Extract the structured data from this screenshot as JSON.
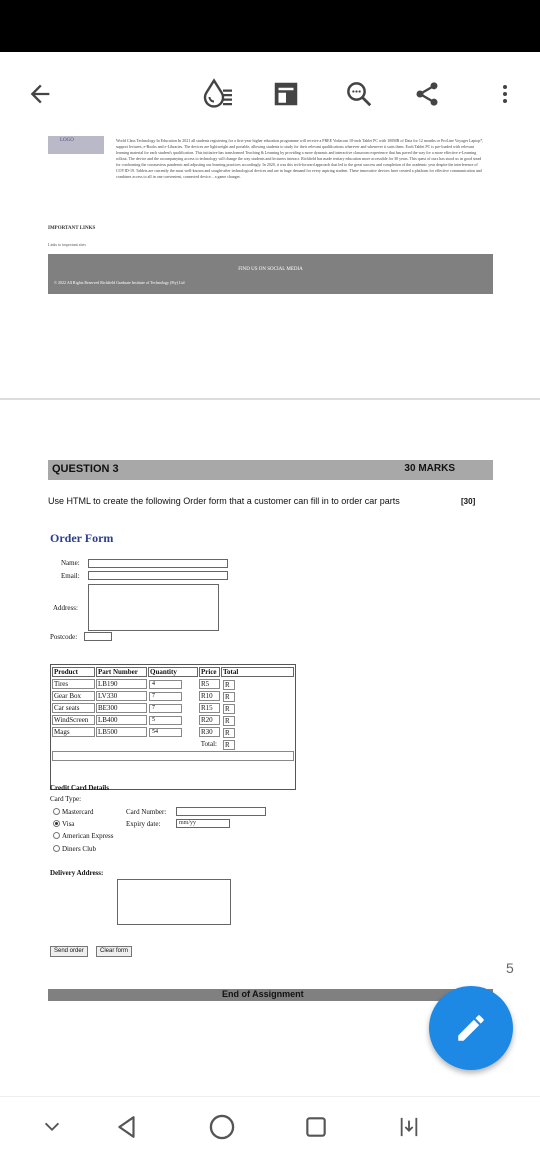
{
  "toolbar": {
    "icons": [
      "back-arrow-icon",
      "color-drop-icon",
      "presentation-icon",
      "search-icon",
      "share-icon",
      "more-vert-icon"
    ]
  },
  "prev_page": {
    "logo_text": "LOGO",
    "paragraph": "World Class Technology In Education In 2021 all students registering for a first-year higher education programme will receive a FREE Vodacom 10-inch Tablet PC with 100MB of Data for 12 months or ProLine Voyager Laptop*, support lectures, e-Books and e-Libraries. The devices are lightweight and portable, allowing students to study for their relevant qualifications wherever and whenever it suits them. Each Tablet PC is pre-loaded with relevant learning material for each student's qualification. This initiative has transformed Teaching & Learning by providing a more dynamic and interactive classroom experience that has paved the way for a more effective e-Learning rollout. The device and the accompanying access to technology will change the way students and lecturers interact. Richfield has made tertiary education more accessible for 30 years. This quest of ours has stood us in good stead for confronting the coronavirus pandemic and adjusting our learning practices accordingly. In 2020, it was this tech-forward approach that led to the great success and completion of the academic year despite the interference of COVID-19. Tablets are currently the most well-known and sought-after technological devices and are in huge demand for every aspiring student. These innovative devices have created a platform for effective communication and combines access to all in one convenient, connected device... a game changer.",
    "important_links": "IMPORTANT LINKS",
    "links_sub": "Links to important sites",
    "find_us": "FIND US ON SOCIAL MEDIA",
    "copyright": "© 2022 All Rights Reserved Richfield Graduate Institute of Technology (Pty) Ltd"
  },
  "question": {
    "label": "QUESTION 3",
    "marks": "30 MARKS",
    "instruction": "Use HTML to create the following Order form that a customer can fill in to order car parts",
    "mark_tag": "[30]"
  },
  "order_form": {
    "title": "Order Form",
    "name_label": "Name:",
    "email_label": "Email:",
    "address_label": "Address:",
    "postcode_label": "Postcode:",
    "columns": [
      "Product",
      "Part Number",
      "Quantity",
      "Price",
      "Total"
    ],
    "rows": [
      {
        "product": "Tires",
        "part": "LB190",
        "qty": "4",
        "price": "R5",
        "total": "R"
      },
      {
        "product": "Gear Box",
        "part": "LV330",
        "qty": "7",
        "price": "R10",
        "total": "R"
      },
      {
        "product": "Car seats",
        "part": "BE300",
        "qty": "7",
        "price": "R15",
        "total": "R"
      },
      {
        "product": "WindScreen",
        "part": "LB400",
        "qty": "5",
        "price": "R20",
        "total": "R"
      },
      {
        "product": "Mags",
        "part": "LB500",
        "qty": "54",
        "price": "R30",
        "total": "R"
      }
    ],
    "total_label": "Total:",
    "total_value": "R",
    "credit_title": "Credit Card Details",
    "card_type_label": "Card Type:",
    "card_options": [
      "Mastercard",
      "Visa",
      "American Express",
      "Diners Club"
    ],
    "selected_card": "Visa",
    "card_number_label": "Card Number:",
    "expiry_label": "Expiry date:",
    "expiry_placeholder": "mm/yy",
    "delivery_label": "Delivery Address:",
    "send_button": "Send order",
    "clear_button": "Clear form"
  },
  "end_text": "End of Assignment",
  "page_number": "5",
  "fab_icon": "pencil-icon",
  "navbar": {
    "icons": [
      "chevron-down-icon",
      "back-triangle-icon",
      "home-circle-icon",
      "recents-square-icon",
      "screenshot-icon"
    ]
  }
}
